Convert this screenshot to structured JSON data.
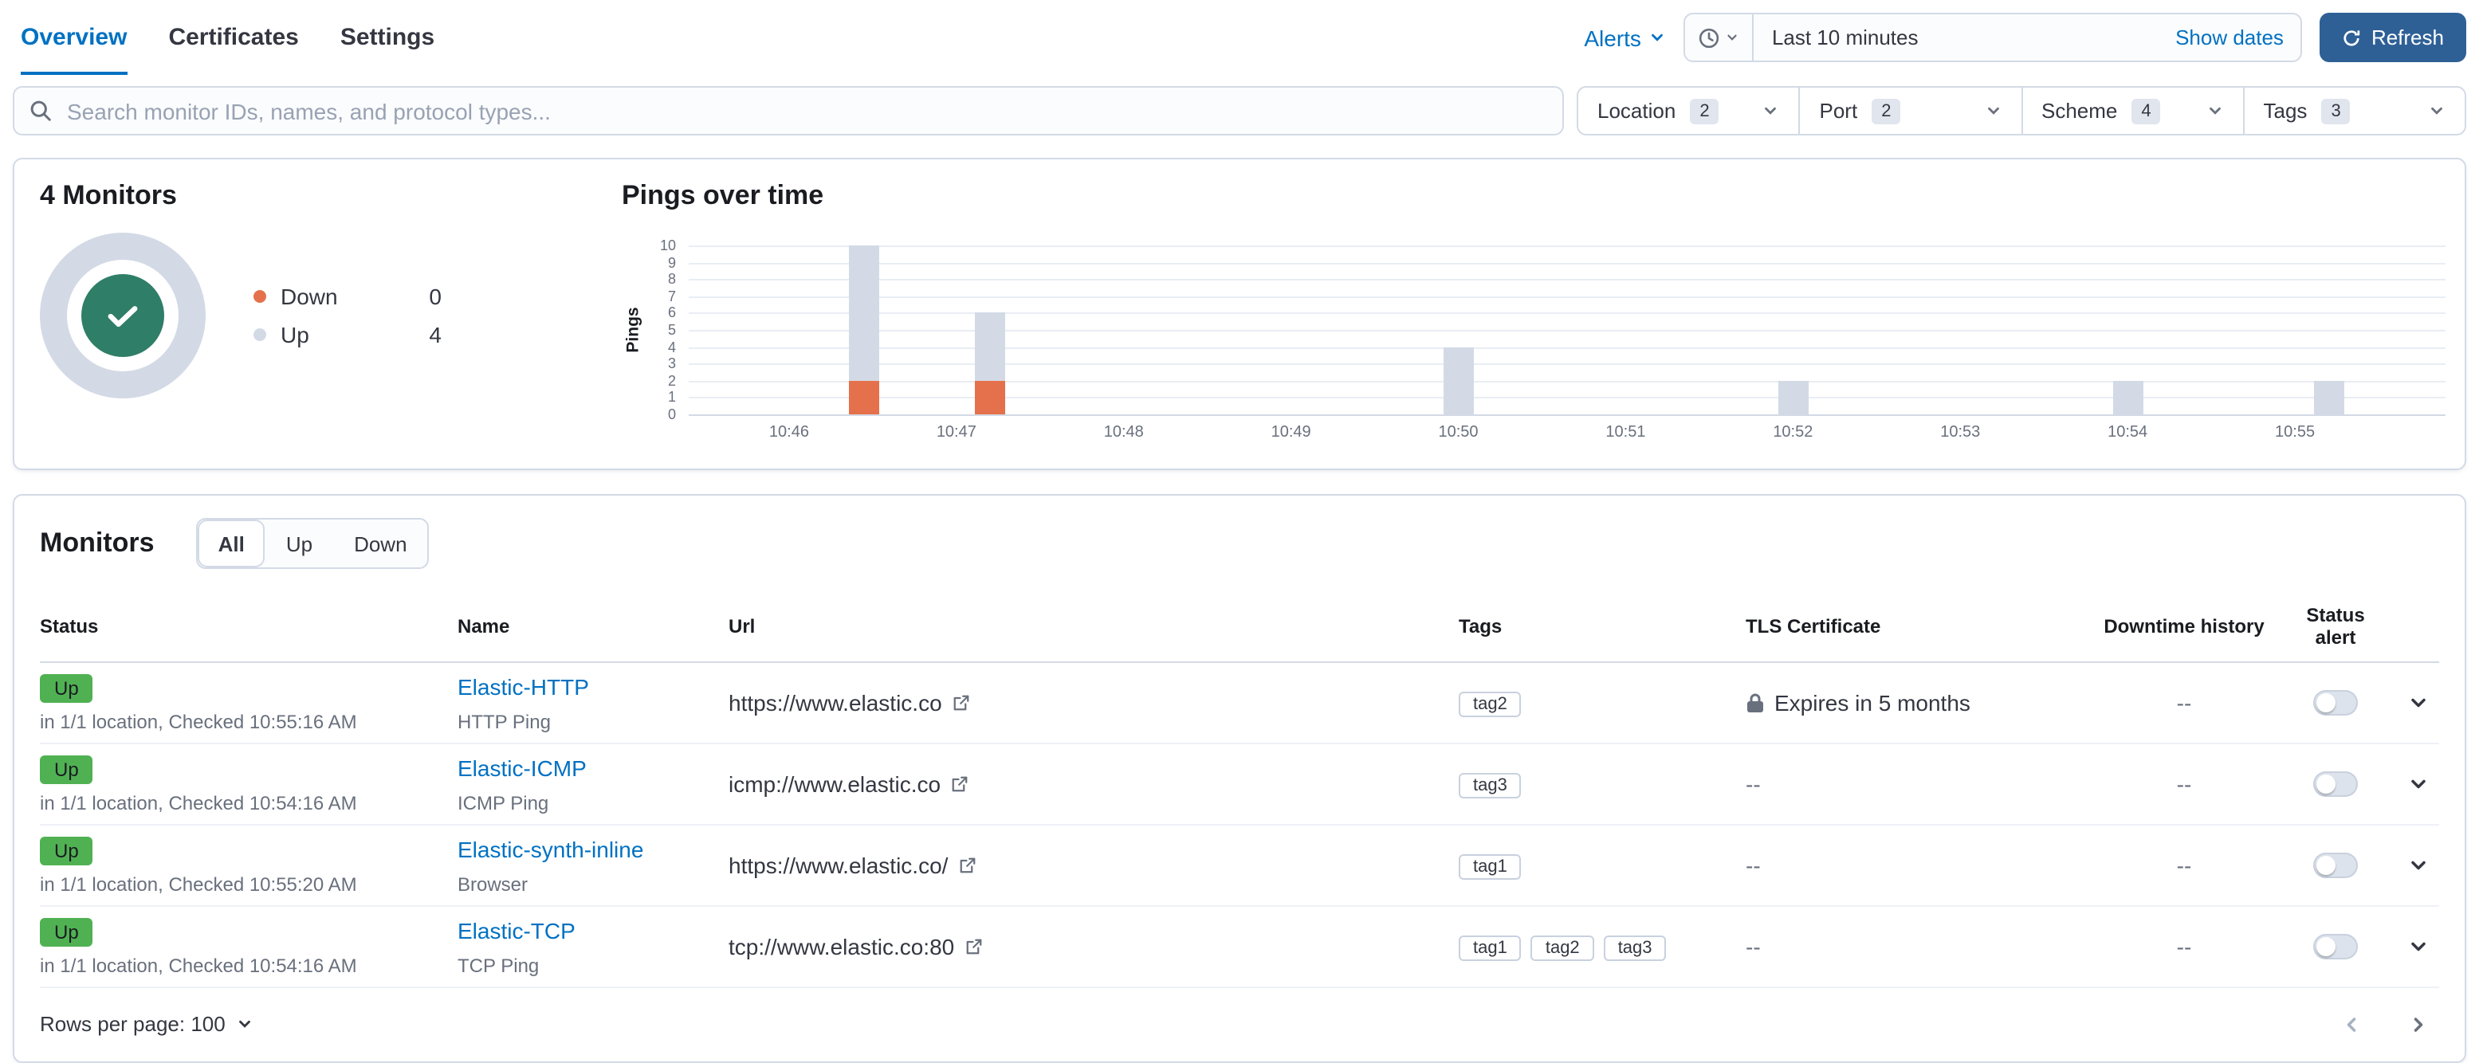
{
  "colors": {
    "primary_link": "#0071c2",
    "refresh_button_bg": "#2e6096",
    "status_up_bg": "#50b153",
    "donut_center_green": "#2f7e67",
    "up_series": "#d3dae6",
    "down_series": "#e5714c",
    "panel_border": "#d3dae6",
    "muted_text": "#69707d"
  },
  "icons": {
    "search-icon": "magnifier",
    "clock-icon": "clock",
    "chevron-down-icon": "chevron-down",
    "refresh-icon": "refresh-arrow",
    "check-icon": "checkmark",
    "lock-icon": "padlock",
    "external-link-icon": "external-link",
    "chevron-left-icon": "chevron-left",
    "chevron-right-icon": "chevron-right"
  },
  "top_nav": {
    "tabs": [
      {
        "label": "Overview",
        "active": true
      },
      {
        "label": "Certificates",
        "active": false
      },
      {
        "label": "Settings",
        "active": false
      }
    ],
    "alerts_label": "Alerts",
    "time_range_value": "Last 10 minutes",
    "show_dates_label": "Show dates",
    "refresh_label": "Refresh"
  },
  "filter_bar": {
    "search_placeholder": "Search monitor IDs, names, and protocol types...",
    "filters": [
      {
        "label": "Location",
        "count": "2"
      },
      {
        "label": "Port",
        "count": "2"
      },
      {
        "label": "Scheme",
        "count": "4"
      },
      {
        "label": "Tags",
        "count": "3"
      }
    ]
  },
  "summary": {
    "title": "4 Monitors",
    "legend": [
      {
        "label": "Down",
        "value": "0",
        "color": "#e5714c"
      },
      {
        "label": "Up",
        "value": "4",
        "color": "#d3dae6"
      }
    ]
  },
  "chart_data": {
    "type": "bar",
    "title": "Pings over time",
    "ylabel": "Pings",
    "ylim": [
      0,
      10
    ],
    "yticks": [
      0,
      1,
      2,
      3,
      4,
      5,
      6,
      7,
      8,
      9,
      10
    ],
    "x_tick_labels": [
      "10:46",
      "10:47",
      "10:48",
      "10:49",
      "10:50",
      "10:51",
      "10:52",
      "10:53",
      "10:54",
      "10:55"
    ],
    "xlim_minutes": [
      -0.6,
      9.9
    ],
    "grid": true,
    "legend_position": "none",
    "series": [
      {
        "name": "Up",
        "color": "#d3dae6"
      },
      {
        "name": "Down",
        "color": "#e5714c"
      }
    ],
    "bars": [
      {
        "t": 0.45,
        "up": 8,
        "down": 2
      },
      {
        "t": 1.2,
        "up": 4,
        "down": 2
      },
      {
        "t": 4.0,
        "up": 4,
        "down": 0
      },
      {
        "t": 6.0,
        "up": 2,
        "down": 0
      },
      {
        "t": 8.0,
        "up": 2,
        "down": 0
      },
      {
        "t": 9.2,
        "up": 2,
        "down": 0
      }
    ]
  },
  "monitors_panel": {
    "title": "Monitors",
    "view_buttons": [
      {
        "label": "All",
        "active": true
      },
      {
        "label": "Up",
        "active": false
      },
      {
        "label": "Down",
        "active": false
      }
    ],
    "columns": [
      "Status",
      "Name",
      "Url",
      "Tags",
      "TLS Certificate",
      "Downtime history",
      "Status alert"
    ],
    "rows": [
      {
        "status": "Up",
        "status_detail": "in 1/1 location, Checked 10:55:16 AM",
        "name": "Elastic-HTTP",
        "type": "HTTP Ping",
        "url": "https://www.elastic.co",
        "tags": [
          "tag2"
        ],
        "tls": "Expires in 5 months",
        "tls_lock": true,
        "downtime": "--"
      },
      {
        "status": "Up",
        "status_detail": "in 1/1 location, Checked 10:54:16 AM",
        "name": "Elastic-ICMP",
        "type": "ICMP Ping",
        "url": "icmp://www.elastic.co",
        "tags": [
          "tag3"
        ],
        "tls": "--",
        "tls_lock": false,
        "downtime": "--"
      },
      {
        "status": "Up",
        "status_detail": "in 1/1 location, Checked 10:55:20 AM",
        "name": "Elastic-synth-inline",
        "type": "Browser",
        "url": "https://www.elastic.co/",
        "tags": [
          "tag1"
        ],
        "tls": "--",
        "tls_lock": false,
        "downtime": "--"
      },
      {
        "status": "Up",
        "status_detail": "in 1/1 location, Checked 10:54:16 AM",
        "name": "Elastic-TCP",
        "type": "TCP Ping",
        "url": "tcp://www.elastic.co:80",
        "tags": [
          "tag1",
          "tag2",
          "tag3"
        ],
        "tls": "--",
        "tls_lock": false,
        "downtime": "--"
      }
    ],
    "rows_per_page_label": "Rows per page: 100"
  }
}
